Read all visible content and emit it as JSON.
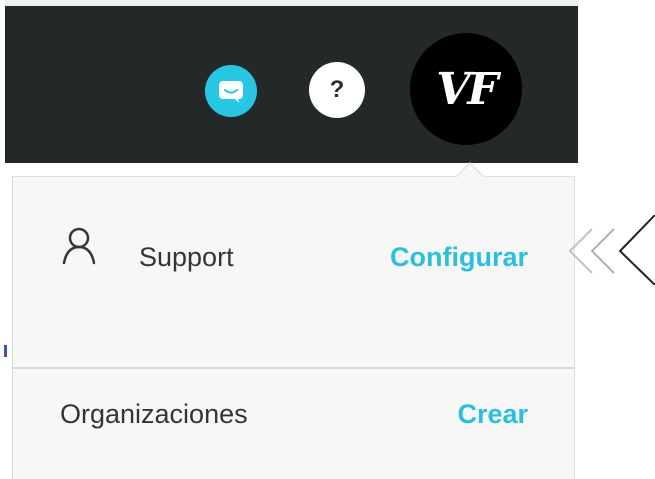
{
  "topbar": {
    "chat_icon": "chat-bubble-icon",
    "help_label": "?",
    "avatar_initials": "VF",
    "colors": {
      "bar": "#232828",
      "chat_button": "#27c6e3",
      "help_button": "#ffffff",
      "avatar": "#000000"
    }
  },
  "menu": {
    "support": {
      "icon": "user-icon",
      "label": "Support",
      "action": "Configurar"
    },
    "organizations": {
      "label": "Organizaciones",
      "action": "Crear"
    },
    "colors": {
      "link": "#2bbfdb",
      "text": "#333538",
      "background": "#f7f7f7"
    }
  },
  "annotation": {
    "icon": "double-chevron-left-icon"
  }
}
